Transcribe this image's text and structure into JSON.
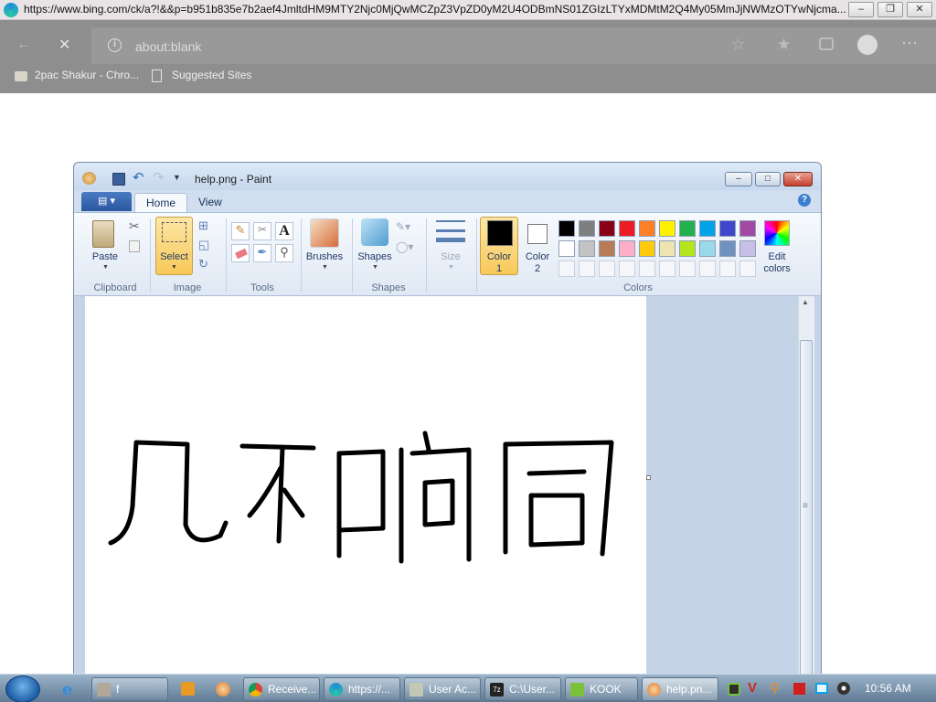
{
  "browser": {
    "url": "https://www.bing.com/ck/a?!&&p=b951b835e7b2aef4JmltdHM9MTY2Njc0MjQwMCZpZ3VpZD0yM2U4ODBmNS01ZGIzLTYxMDMtM2Q4My05MmJjNWMzOTYwNjcma...",
    "address": "about:blank",
    "favorites": [
      "2pac Shakur - Chro...",
      "Suggested Sites"
    ]
  },
  "paint": {
    "title": "help.png - Paint",
    "tabs": [
      "Home",
      "View"
    ],
    "groups": {
      "clipboard": "Clipboard",
      "image": "Image",
      "tools": "Tools",
      "shapes": "Shapes",
      "colors": "Colors"
    },
    "buttons": {
      "paste": "Paste",
      "select": "Select",
      "brushes": "Brushes",
      "shapes": "Shapes",
      "size": "Size",
      "color1_line1": "Color",
      "color1_line2": "1",
      "color2_line1": "Color",
      "color2_line2": "2",
      "edit_colors_line1": "Edit",
      "edit_colors_line2": "colors"
    },
    "palette_row1": [
      "#000000",
      "#7f7f7f",
      "#880015",
      "#ed1c24",
      "#ff7f27",
      "#fff200",
      "#22b14c",
      "#00a2e8",
      "#3f48cc",
      "#a349a4"
    ],
    "palette_row2": [
      "#ffffff",
      "#c3c3c3",
      "#b97a57",
      "#ffaec9",
      "#ffc90e",
      "#efe4b0",
      "#b5e61d",
      "#99d9ea",
      "#7092be",
      "#c8bfe7"
    ],
    "color1": "#000000",
    "color2": "#ffffff"
  },
  "taskbar": {
    "items": [
      "f",
      "Receive...",
      "https://...",
      "User Ac...",
      "C:\\User...",
      "KOOK",
      "help.pn..."
    ],
    "clock": "10:56 AM"
  }
}
